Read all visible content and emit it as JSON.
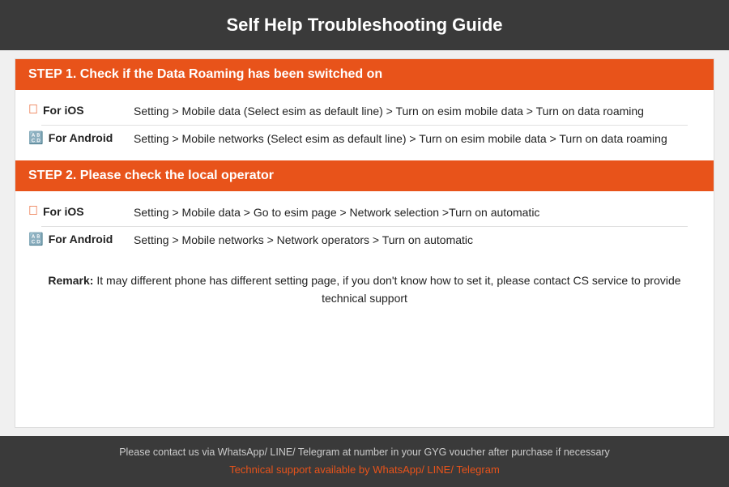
{
  "header": {
    "title": "Self Help Troubleshooting Guide"
  },
  "step1": {
    "heading": "STEP 1.  Check if the Data Roaming has been switched on",
    "ios_label": "For iOS",
    "ios_text": "Setting > Mobile data (Select esim as default line) > Turn on esim mobile data > Turn on data roaming",
    "android_label": "For Android",
    "android_text": "Setting > Mobile networks (Select esim as default line) > Turn on esim mobile data > Turn on data roaming"
  },
  "step2": {
    "heading": "STEP 2.  Please check the local operator",
    "ios_label": "For iOS",
    "ios_text": "Setting > Mobile data > Go to esim page > Network selection >Turn on automatic",
    "android_label": "For Android",
    "android_text": "Setting > Mobile networks > Network operators > Turn on automatic"
  },
  "remark": {
    "label": "Remark:",
    "text": "It may different phone has different setting page, if you don't know how to set it,  please contact CS service to provide technical support"
  },
  "footer": {
    "contact_text": "Please contact us via WhatsApp/ LINE/ Telegram at number in your GYG voucher after purchase if necessary",
    "support_text": "Technical support available by WhatsApp/ LINE/ Telegram"
  }
}
